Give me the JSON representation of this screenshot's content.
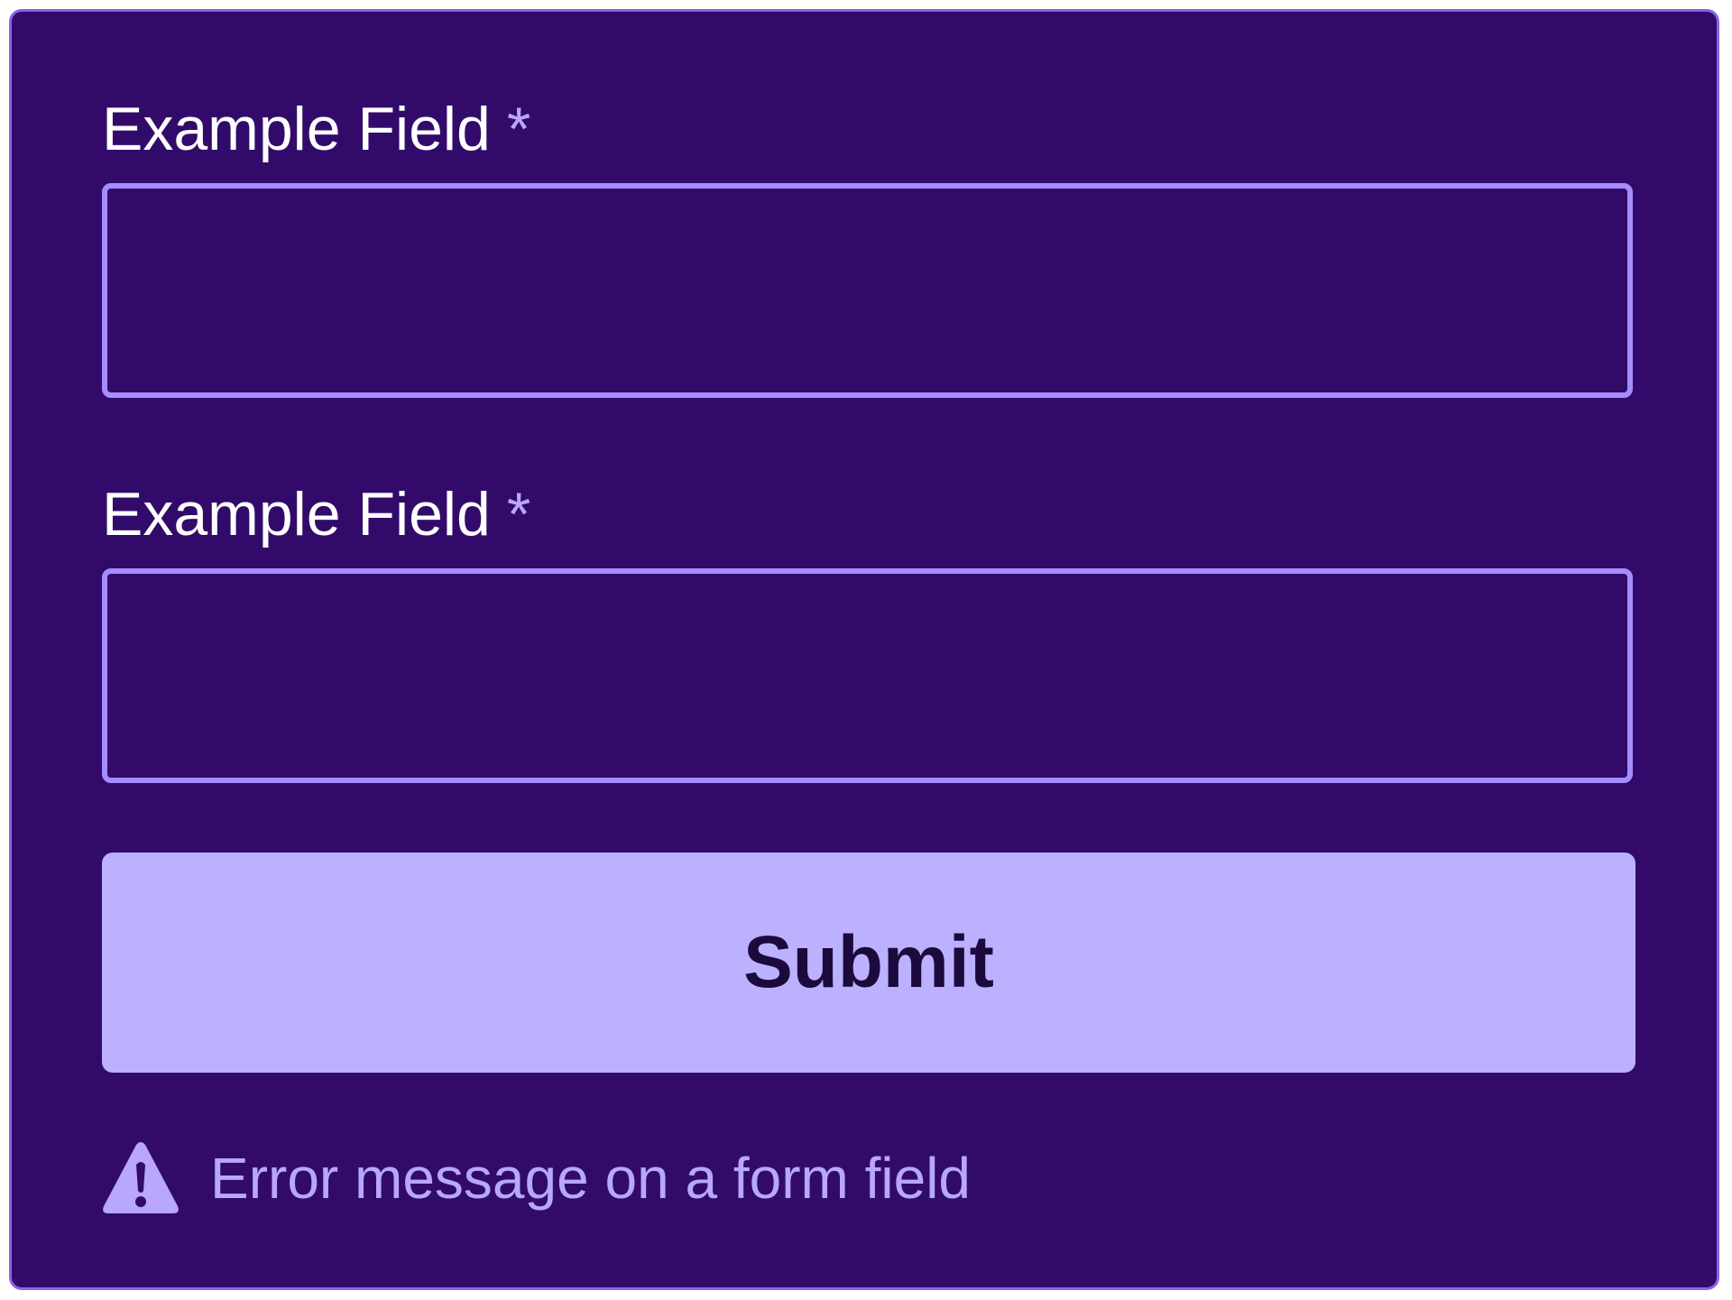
{
  "form": {
    "fields": [
      {
        "label": "Example Field",
        "required_marker": "*",
        "value": "",
        "placeholder": ""
      },
      {
        "label": "Example Field",
        "required_marker": "*",
        "value": "",
        "placeholder": ""
      }
    ],
    "submit_label": "Submit",
    "error": {
      "icon": "warning-triangle-icon",
      "message": "Error message on a form field"
    }
  },
  "colors": {
    "background": "#320b6a",
    "panel_border": "#8a63e8",
    "input_border": "#a58cff",
    "button_fill": "#bcb1fe",
    "button_text": "#1c0a3d",
    "accent_text": "#b8a6ff",
    "label_text": "#ffffff"
  }
}
